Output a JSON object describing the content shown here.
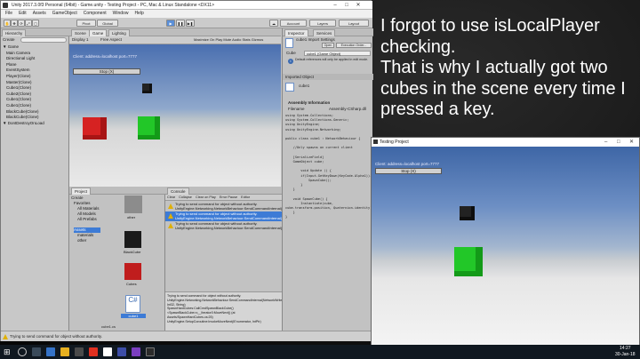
{
  "editor": {
    "title": "Unity 2017.3.0f3 Personal (64bit) - Game.unity - Testing Project - PC, Mac & Linux Standalone <DX11>",
    "menu": [
      "File",
      "Edit",
      "Assets",
      "GameObject",
      "Component",
      "Window",
      "Help"
    ],
    "toolbar": {
      "pivot": "Pivot",
      "global": "Global",
      "account": "Account",
      "layers": "Layers",
      "layout": "Layout"
    }
  },
  "hierarchy": {
    "tab": "Hierarchy",
    "create": "Create",
    "items": [
      {
        "label": "▼ Game",
        "sel": false,
        "indent": 1
      },
      {
        "label": "Main Camera",
        "sel": false,
        "indent": 3
      },
      {
        "label": "Directional Light",
        "sel": false,
        "indent": 3
      },
      {
        "label": "Plane",
        "sel": false,
        "indent": 3
      },
      {
        "label": "EventSystem",
        "sel": false,
        "indent": 3
      },
      {
        "label": "Player(Clone)",
        "sel": false,
        "indent": 3
      },
      {
        "label": "Master(Clone)",
        "sel": false,
        "indent": 3
      },
      {
        "label": "Cube1(Clone)",
        "sel": false,
        "indent": 3
      },
      {
        "label": "Cube2(Clone)",
        "sel": false,
        "indent": 3
      },
      {
        "label": "Cube1(Clone)",
        "sel": false,
        "indent": 3
      },
      {
        "label": "Cube1(Clone)",
        "sel": false,
        "indent": 3
      },
      {
        "label": "BlackCube(Clone)",
        "sel": false,
        "indent": 3
      },
      {
        "label": "BlackCube(Clone)",
        "sel": false,
        "indent": 3
      },
      {
        "label": "▼ DontDestroyOnLoad",
        "sel": false,
        "indent": 1
      }
    ]
  },
  "scene": {
    "tabs": [
      "Scene",
      "Game",
      "Lighting"
    ],
    "display": "Display 1",
    "aspect": "Free Aspect",
    "toggles": "Maximize On Play  Mute Audio  Stats  Gizmos",
    "client_text": "Client: address=localhost port=7777",
    "stop_label": "Stop (X)"
  },
  "project": {
    "tabs": [
      "Project",
      "Console"
    ],
    "create": "Create",
    "favorites": [
      "Favorites",
      "All Materials",
      "All Models",
      "All Prefabs"
    ],
    "assets": [
      "Assets",
      "materials",
      "other"
    ],
    "files": [
      "other",
      "BlackCube",
      "Cubes",
      "cube1",
      "cube1.cs"
    ]
  },
  "console": {
    "buttons": [
      "Clear",
      "Collapse",
      "Clear on Play",
      "Error Pause",
      "Editor"
    ],
    "logs": [
      {
        "text": "Trying to send command for object without authority.\nUnityEngine.Networking.NetworkBehaviour:SendCommandInternal(...)",
        "sel": false
      },
      {
        "text": "Trying to send command for object without authority.\nUnityEngine.Networking.NetworkBehaviour:SendCommandInternal(...)",
        "sel": true
      },
      {
        "text": "Trying to send command for object without authority.\nUnityEngine.Networking.NetworkBehaviour:SendCommandInternal(...)",
        "sel": false
      }
    ],
    "detail": "Trying to send command for object without authority.\nUnityEngine.Networking.NetworkBehaviour:SendCommandInternal(NetworkWriter, Int32, String)\nSpawnHardCubes:CallCmdSpawnBlackCube()\n<SpawnBlackCube>c__Iterator0:MoveNext() (at\nAssets/SpawnHardCubes.cs:25)\nUnityEngine.SetupCoroutine:InvokeMoveNext(IEnumerator, IntPtr)",
    "asset_labels": "Asset Labels"
  },
  "inspector": {
    "tabs": [
      "Inspector",
      "Services"
    ],
    "title": "cube1 Import Settings",
    "open": "Open",
    "execution_order": "Execution Order...",
    "cube_label": "Cube",
    "cube_value": "cube1 (Game Object)",
    "default_refs": "Default references will only be applied in edit mode.",
    "imported_object": "Imported Object",
    "imported_name": "cube1",
    "assembly_info": "Assembly Information",
    "filename_label": "Filename",
    "filename_value": "Assembly-CSharp.dll",
    "code": "using System.Collections;\nusing System.Collections.Generic;\nusing UnityEngine;\nusing UnityEngine.Networking;\n\npublic class cube1 : NetworkBehaviour {\n\n    //Only spawns on current client\n\n    [SerializeField]\n    GameObject cube;\n\n        void Update () {\n        if(Input.GetKeyDown(KeyCode.Alpha1)){\n            SpawnCube();\n        }\n    }\n\n    void SpawnCube() {\n        Instantiate(cube,\ncube.transform.position, Quaternion.identity);\n    }\n}"
  },
  "status": {
    "text": "Trying to send command for object without authority."
  },
  "game_window": {
    "title": "Testing Project",
    "client_text": "Client: address=localhost port=7777",
    "stop_label": "Stop (X)"
  },
  "caption": {
    "text": "I forgot to use isLocalPlayer checking.\nThat is why I actually got two cubes in the scene every time I pressed a key."
  },
  "taskbar": {
    "time": "14:27",
    "date": "30-Jan-18"
  },
  "colors": {
    "cube_red": "#d62222",
    "cube_green": "#22c728",
    "cube_black": "#222222",
    "selection": "#3d7bd6"
  }
}
